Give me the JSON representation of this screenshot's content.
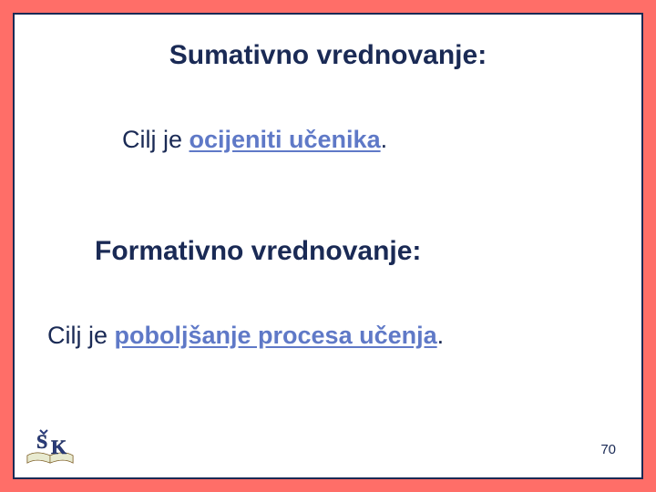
{
  "slide": {
    "heading1": "Sumativno vrednovanje:",
    "line1_prefix": "Cilj je ",
    "line1_emph": "ocijeniti učenika",
    "line1_suffix": ".",
    "heading2": "Formativno vrednovanje:",
    "line2_prefix": "Cilj je ",
    "line2_emph": "poboljšanje procesa učenja",
    "line2_suffix": ".",
    "page_number": "70"
  }
}
